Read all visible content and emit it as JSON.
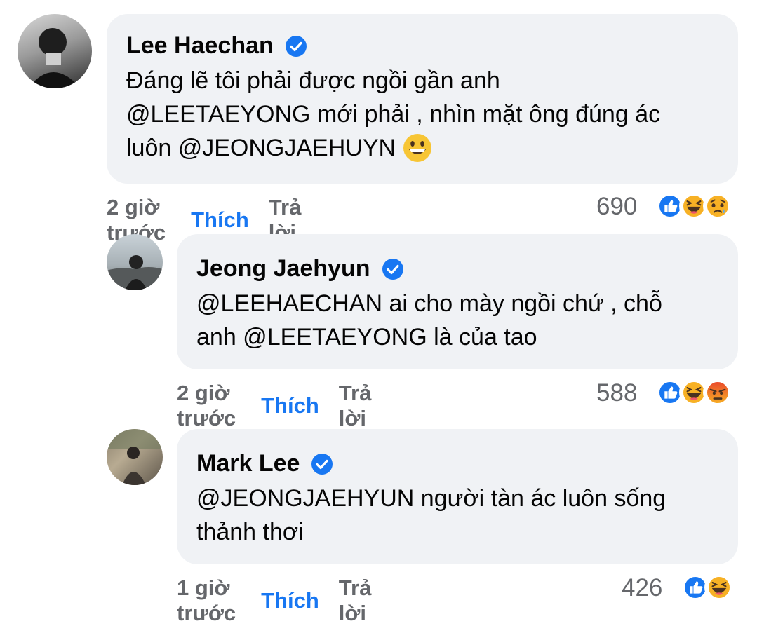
{
  "comments": [
    {
      "author": "Lee Haechan",
      "text_lines": [
        "Đáng lẽ tôi phải được ngồi gần anh",
        "@LEETAEYONG mới phải , nhìn mặt ông đúng ác",
        "luôn @JEONGJAEHUYN"
      ],
      "time": "2 giờ trước",
      "like_label": "Thích",
      "reply_label": "Trả lời",
      "reaction_count": "690",
      "reactions": [
        "like-icon",
        "haha-icon",
        "sad-icon"
      ]
    },
    {
      "author": "Jeong Jaehyun",
      "text_lines": [
        "@LEEHAECHAN ai cho mày ngồi chứ , chỗ",
        "anh @LEETAEYONG là của tao"
      ],
      "time": "2 giờ trước",
      "like_label": "Thích",
      "reply_label": "Trả lời",
      "reaction_count": "588",
      "reactions": [
        "like-icon",
        "haha-icon",
        "angry-icon"
      ]
    },
    {
      "author": "Mark Lee",
      "text_lines": [
        "@JEONGJAEHYUN người tàn ác luôn sống",
        "thảnh thơi"
      ],
      "time": "1 giờ trước",
      "like_label": "Thích",
      "reply_label": "Trả lời",
      "reaction_count": "426",
      "reactions": [
        "like-icon",
        "haha-icon"
      ]
    }
  ],
  "colors": {
    "bubble": "#f0f2f5",
    "link_blue": "#1877f2",
    "meta_gray": "#65676b",
    "verified_blue": "#1877f2"
  }
}
